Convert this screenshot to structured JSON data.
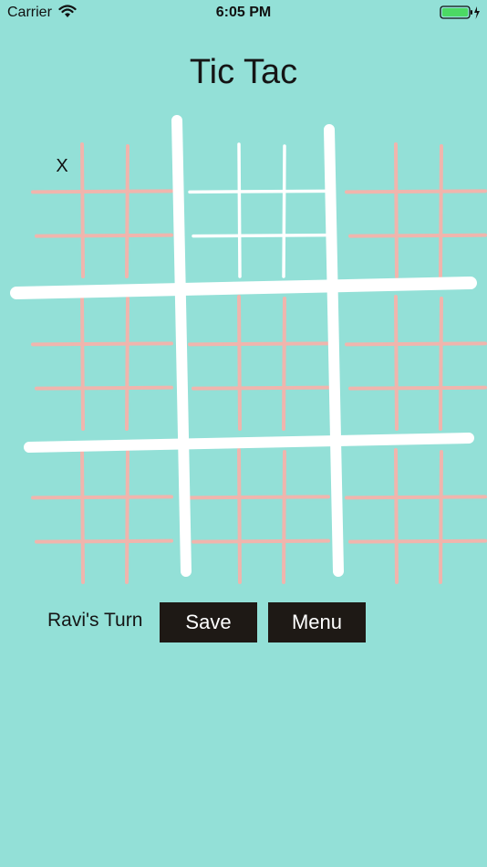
{
  "status_bar": {
    "carrier": "Carrier",
    "time": "6:05 PM"
  },
  "title": "Tic Tac",
  "board": {
    "rows": 3,
    "cols": 3,
    "active_sub_board": 1,
    "marks": [
      {
        "board": 0,
        "cell": 0,
        "symbol": "X"
      }
    ]
  },
  "footer": {
    "turn_label": "Ravi's Turn",
    "save_label": "Save",
    "menu_label": "Menu"
  },
  "colors": {
    "background": "#93e0d7",
    "inactive_grid": "#f0b5ad",
    "active_grid": "#ffffff",
    "main_grid": "#ffffff",
    "button_bg": "#1e1915",
    "button_text": "#ffffff"
  }
}
